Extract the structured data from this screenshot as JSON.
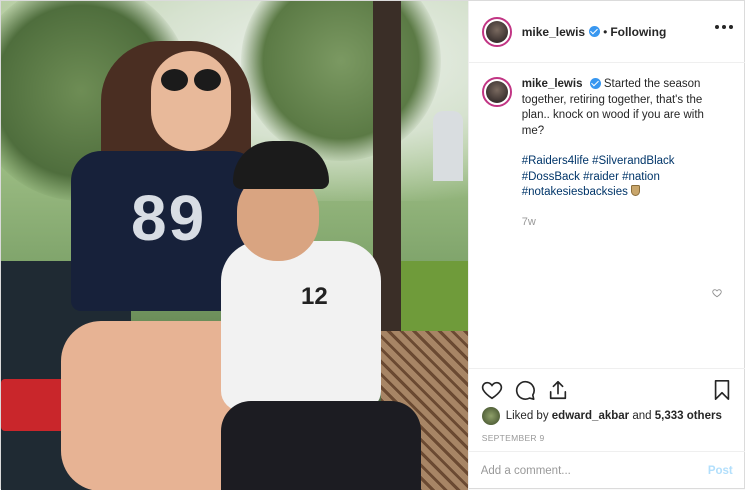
{
  "post": {
    "image_alt": "photo of a couple sitting on a sofa wearing Raiders jerseys",
    "jersey_numbers": [
      "89",
      "12"
    ]
  },
  "header": {
    "username": "mike_lewis",
    "separator": "•",
    "follow_status": "Following",
    "more_icon": "more-horizontal-icon"
  },
  "caption": {
    "username": "mike_lewis",
    "text": "Started the season together, retiring together, that's the plan.. knock on wood if you are with me?",
    "hashtags": [
      "#Raiders4life",
      "#SilverandBlack",
      "#DossBack",
      "#raider",
      "#nation",
      "#notakesiesbacksies"
    ],
    "emoji": "shield-emoji",
    "time_ago": "7w"
  },
  "actions": {
    "like_icon": "heart-icon",
    "comment_icon": "comment-icon",
    "share_icon": "share-icon",
    "save_icon": "bookmark-icon"
  },
  "likes": {
    "prefix": "Liked by",
    "user": "edward_akbar",
    "conjunction": "and",
    "others": "5,333 others"
  },
  "date": "SEPTEMBER 9",
  "comment": {
    "placeholder": "Add a comment...",
    "post_label": "Post"
  },
  "colors": {
    "link": "#003569",
    "verified": "#3897f0",
    "post_button": "#b2dffc",
    "border": "#dbdbdb"
  }
}
